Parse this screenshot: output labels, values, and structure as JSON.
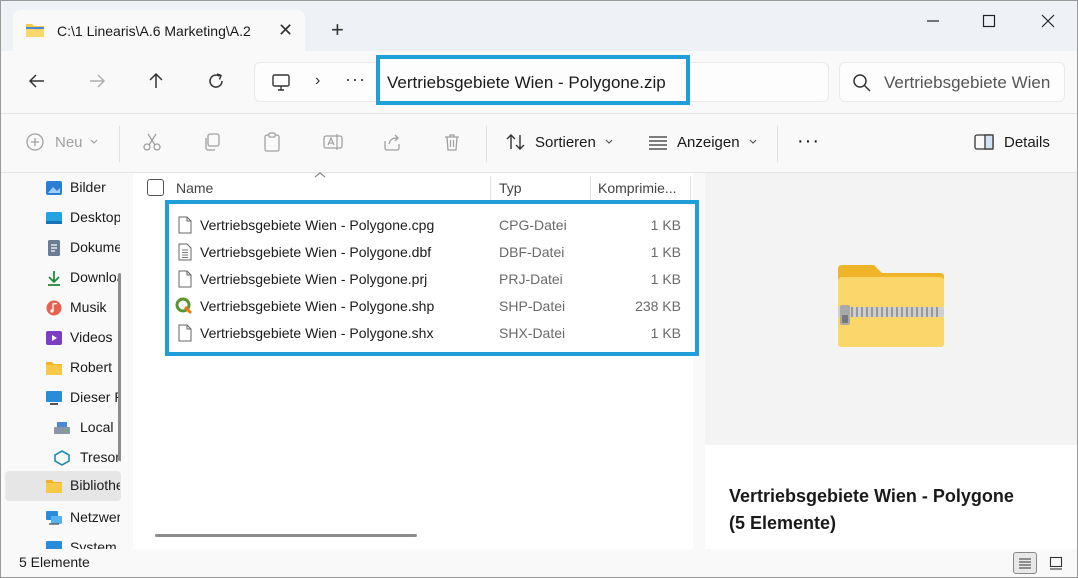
{
  "tab": {
    "title": "C:\\1 Linearis\\A.6 Marketing\\A.2",
    "close": "✕"
  },
  "newtab": "+",
  "window_controls": {
    "minimize": "—",
    "maximize": "☐",
    "close": "✕"
  },
  "address": {
    "chevron": "›",
    "more": "···",
    "current": "Vertriebsgebiete Wien - Polygone.zip"
  },
  "search": {
    "placeholder": "Vertriebsgebiete Wien"
  },
  "toolbar": {
    "new_label": "Neu",
    "sort_label": "Sortieren",
    "view_label": "Anzeigen",
    "more_label": "···",
    "details_label": "Details"
  },
  "sidebar": {
    "items": [
      {
        "label": "Bilder",
        "icon": "pictures-icon"
      },
      {
        "label": "Desktop",
        "icon": "desktop-icon"
      },
      {
        "label": "Dokumente",
        "icon": "documents-icon"
      },
      {
        "label": "Downloads",
        "icon": "downloads-icon"
      },
      {
        "label": "Musik",
        "icon": "music-icon"
      },
      {
        "label": "Videos",
        "icon": "videos-icon"
      },
      {
        "label": "Robert",
        "icon": "folder-icon"
      },
      {
        "label": "Dieser PC",
        "icon": "pc-icon"
      },
      {
        "label": "Local",
        "icon": "drive-icon"
      },
      {
        "label": "Tresorit",
        "icon": "tresorit-icon"
      },
      {
        "label": "Bibliotheken",
        "icon": "library-icon"
      },
      {
        "label": "Netzwerk",
        "icon": "network-icon"
      },
      {
        "label": "System",
        "icon": "system-icon"
      }
    ]
  },
  "columns": {
    "name": "Name",
    "type": "Typ",
    "compressed": "Komprimie..."
  },
  "files": [
    {
      "name": "Vertriebsgebiete Wien - Polygone.cpg",
      "type": "CPG-Datei",
      "size": "1 KB",
      "icon": "file-icon"
    },
    {
      "name": "Vertriebsgebiete Wien - Polygone.dbf",
      "type": "DBF-Datei",
      "size": "1 KB",
      "icon": "text-file-icon"
    },
    {
      "name": "Vertriebsgebiete Wien - Polygone.prj",
      "type": "PRJ-Datei",
      "size": "1 KB",
      "icon": "file-icon"
    },
    {
      "name": "Vertriebsgebiete Wien - Polygone.shp",
      "type": "SHP-Datei",
      "size": "238 KB",
      "icon": "qgis-icon"
    },
    {
      "name": "Vertriebsgebiete Wien - Polygone.shx",
      "type": "SHX-Datei",
      "size": "1 KB",
      "icon": "file-icon"
    }
  ],
  "details": {
    "title_line1": "Vertriebsgebiete Wien - Polygone",
    "title_line2": "(5 Elemente)"
  },
  "status": {
    "count": "5 Elemente"
  },
  "colors": {
    "highlight": "#1e9fd8",
    "folder": "#f7c948",
    "qgis": "#589632"
  }
}
